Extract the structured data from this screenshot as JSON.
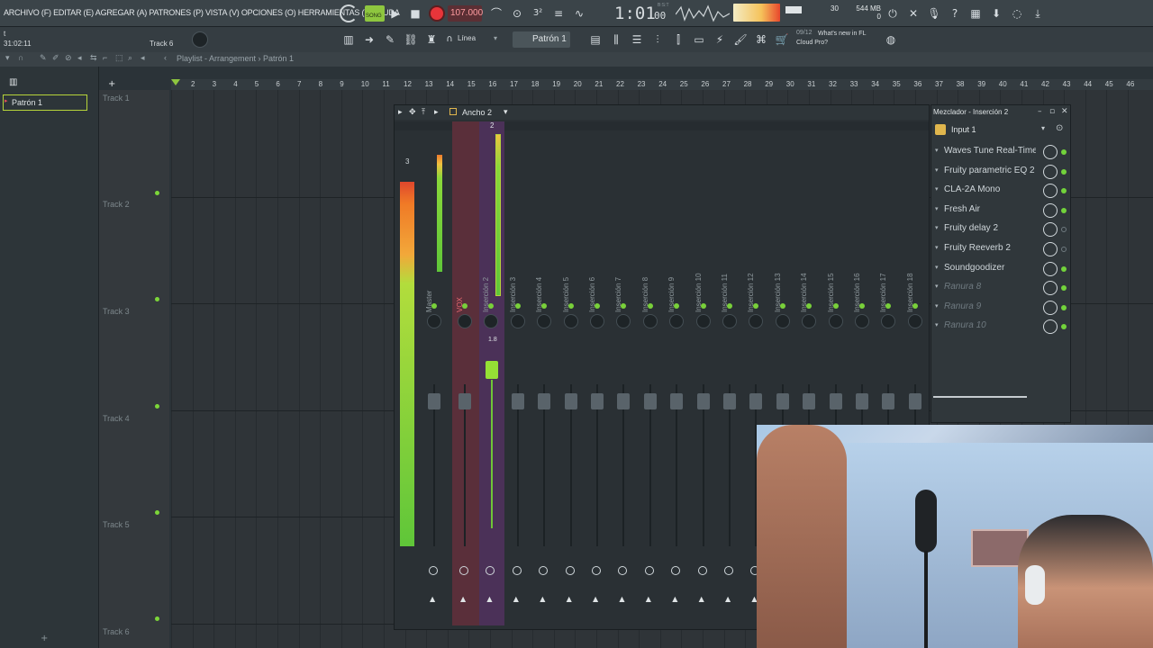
{
  "menu": {
    "items": [
      "ARCHIVO (F)",
      "EDITAR (E)",
      "AGREGAR (A)",
      "PATRONES (P)",
      "VISTA (V)",
      "OPCIONES (O)",
      "HERRAMIENTAS (T)",
      "AYUDA"
    ]
  },
  "transport": {
    "song_badge": "SONG",
    "bpm": "107.000",
    "time": "1:01",
    "time_sub": "00",
    "time_label": "B:S:T",
    "cpu": "30",
    "memory": "544 MB",
    "mem_sub": "0"
  },
  "hint": {
    "text": "t",
    "time": "31:02:11",
    "track": "Track 6"
  },
  "toolbar2": {
    "snap": "Línea",
    "pattern": "Patrón 1",
    "news_date": "09/12",
    "news_title": "What's new in FL Cloud Pro?"
  },
  "playlist": {
    "breadcrumb": "Playlist - Arrangement › Patrón 1",
    "selected_pattern": "Patrón 1",
    "tracks": [
      "Track 1",
      "Track 2",
      "Track 3",
      "Track 4",
      "Track 5",
      "Track 6"
    ],
    "timeline": [
      "2",
      "3",
      "4",
      "5",
      "6",
      "7",
      "8",
      "9",
      "10",
      "11",
      "12",
      "13",
      "14",
      "15",
      "16",
      "17",
      "18",
      "19",
      "20",
      "21",
      "22",
      "23",
      "24",
      "25",
      "26",
      "27",
      "28",
      "29",
      "30",
      "31",
      "32",
      "33",
      "34",
      "35",
      "36",
      "37",
      "38",
      "39",
      "40",
      "41",
      "42",
      "43",
      "44",
      "45",
      "46"
    ]
  },
  "mixer": {
    "header": "Ancho 2",
    "insert_numbers": [
      "3",
      "2"
    ],
    "fader_readout": "1.8",
    "strips": [
      "Master",
      "VOX",
      "Inserción 2",
      "Inserción 3",
      "Inserción 4",
      "Inserción 5",
      "Inserción 6",
      "Inserción 7",
      "Inserción 8",
      "Inserción 9",
      "Inserción 10",
      "Inserción 11",
      "Inserción 12",
      "Inserción 13",
      "Inserción 14",
      "Inserción 15",
      "Inserción 16",
      "Inserción 17",
      "Inserción 18"
    ]
  },
  "inspector": {
    "title": "Mezclador - Inserción 2",
    "input": "Input 1",
    "slots": [
      {
        "name": "Waves Tune Real-Time",
        "active": true
      },
      {
        "name": "Fruity parametric EQ 2",
        "active": true
      },
      {
        "name": "CLA-2A Mono",
        "active": true
      },
      {
        "name": "Fresh Air",
        "active": true
      },
      {
        "name": "Fruity delay 2",
        "active": false
      },
      {
        "name": "Fruity Reeverb 2",
        "active": false
      },
      {
        "name": "Soundgoodizer",
        "active": true
      },
      {
        "name": "Ranura 8",
        "active": true
      },
      {
        "name": "Ranura 9",
        "active": true
      },
      {
        "name": "Ranura 10",
        "active": true
      }
    ]
  },
  "colors": {
    "accent_green": "#7cd639",
    "record_red": "#e7353a",
    "vox_strip": "#5a2f3a",
    "selected_strip": "#4b3158"
  }
}
